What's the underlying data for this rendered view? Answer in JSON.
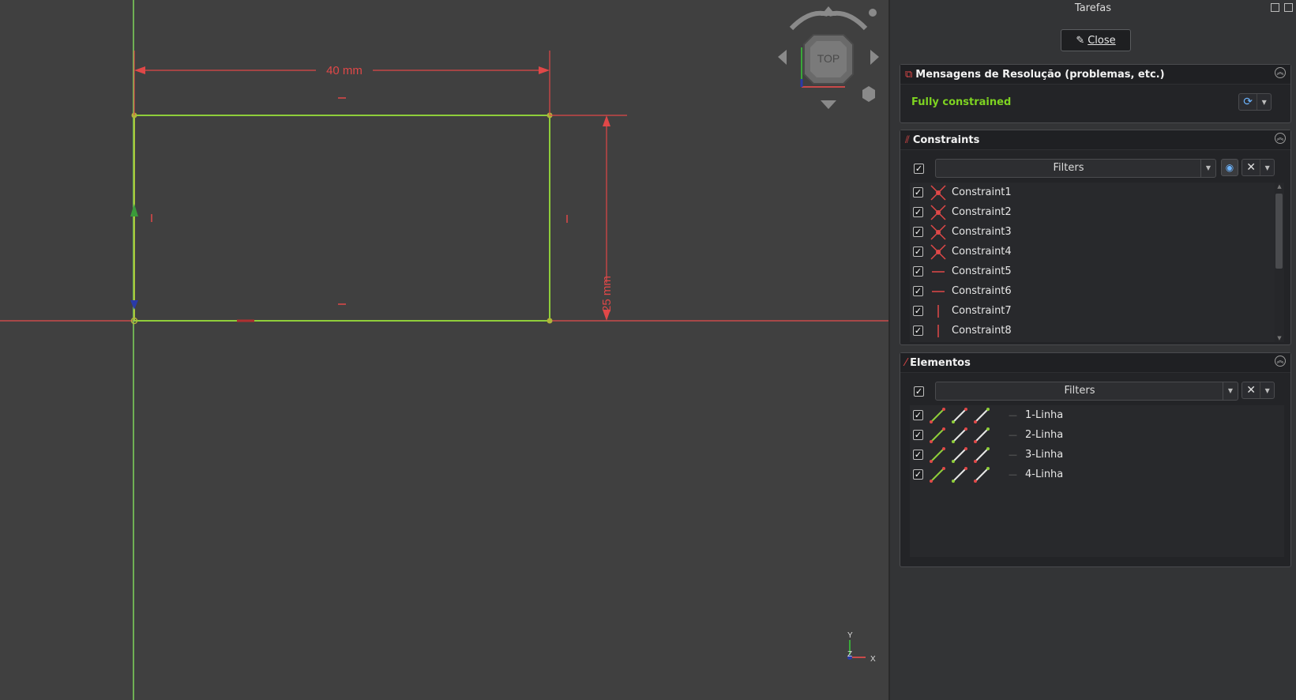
{
  "viewport": {
    "dimension_horizontal": "40 mm",
    "dimension_vertical": "25 mm",
    "navcube_face": "TOP",
    "axis_x": "X",
    "axis_y": "Y",
    "axis_z": "Z"
  },
  "panel": {
    "title": "Tarefas",
    "close_label": "Close",
    "solver": {
      "title": "Mensagens de Resolução (problemas, etc.)",
      "status": "Fully constrained",
      "status_color": "#7ed321"
    },
    "constraints": {
      "title": "Constraints",
      "filter_label": "Filters",
      "items": [
        {
          "label": "Constraint1",
          "icon": "coincident-icon",
          "checked": true
        },
        {
          "label": "Constraint2",
          "icon": "coincident-icon",
          "checked": true
        },
        {
          "label": "Constraint3",
          "icon": "coincident-icon",
          "checked": true
        },
        {
          "label": "Constraint4",
          "icon": "coincident-icon",
          "checked": true
        },
        {
          "label": "Constraint5",
          "icon": "horizontal-icon",
          "checked": true
        },
        {
          "label": "Constraint6",
          "icon": "horizontal-icon",
          "checked": true
        },
        {
          "label": "Constraint7",
          "icon": "vertical-icon",
          "checked": true
        },
        {
          "label": "Constraint8",
          "icon": "vertical-icon",
          "checked": true
        }
      ]
    },
    "elements": {
      "title": "Elementos",
      "filter_label": "Filters",
      "items": [
        {
          "label": "1-Linha",
          "checked": true
        },
        {
          "label": "2-Linha",
          "checked": true
        },
        {
          "label": "3-Linha",
          "checked": true
        },
        {
          "label": "4-Linha",
          "checked": true
        }
      ]
    }
  },
  "colors": {
    "constraint_red": "#e04848",
    "geometry_green": "#8fce3a",
    "accent_blue": "#3a7bd5"
  }
}
